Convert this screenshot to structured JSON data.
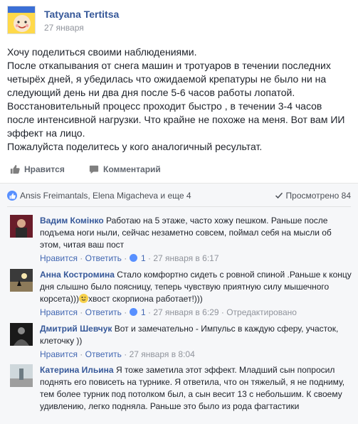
{
  "post": {
    "author": "Tatyana Tertitsa",
    "date": "27 января",
    "paragraphs": [
      "Хочу поделиться своими наблюдениями.",
      "После откапывания от снега машин и тротуаров в течении последних четырёх дней, я убедилась что ожидаемой крепатуры не было ни на следующий день ни два дня после 5-6 часов работы лопатой.",
      "Восстановительный процесс проходит быстро , в течении 3-4 часов после интенсивной нагрузки. Что крайне не похоже на меня. Вот вам ИИ эффект на лицо.",
      "Пожалуйста поделитесь у кого аналогичный ресультат."
    ]
  },
  "actions": {
    "like_label": "Нравится",
    "comment_label": "Комментарий"
  },
  "reactions": {
    "likers": "Ansis Freimantals, Elena Migacheva и еще 4",
    "views": "Просмотрено 84"
  },
  "comments": [
    {
      "name": "Вадим Комінко",
      "text": "Работаю на 5 этаже, часто хожу пешком. Раньше после подъема ноги ныли, сейчас незаметно совсем, поймал себя на мысли об этом, читая ваш пост",
      "like": "Нравится",
      "reply": "Ответить",
      "likes": "1",
      "time": "27 января в 6:17"
    },
    {
      "name": "Анна Костромина",
      "text_before": "Стало комфортно сидеть с ровной спиной .Раньше к концу дня слышно было поясницу, теперь чувствую приятную силу мышечного корсета)))",
      "text_after": "хвост скорпиона работает!)))",
      "like": "Нравится",
      "reply": "Ответить",
      "likes": "1",
      "time": "27 января в 6:29",
      "edited": "Отредактировано"
    },
    {
      "name": "Дмитрий Шевчук",
      "text": "Вот и замечательно - Импульс в каждую сферу, участок, клеточку ))",
      "like": "Нравится",
      "reply": "Ответить",
      "time": "27 января в 8:04"
    },
    {
      "name": "Катерина Ильина",
      "text": "Я тоже заметила этот эффект. Младший сын попросил поднять его повисеть на турнике. Я ответила, что он тяжелый, я не подниму, тем более турник под потолком был, а сын весит 13 с небольшим. К своему удивлению, легко подняла. Раньше это было из рода фагтастики"
    }
  ]
}
